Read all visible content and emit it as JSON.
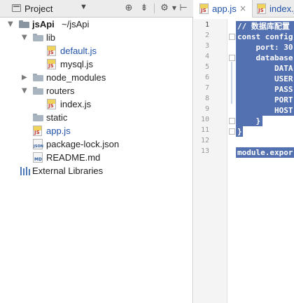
{
  "project_panel": {
    "title": "Project",
    "dropdown_icon": "triangle-down-icon",
    "toolbar_icons": [
      "crosshair-icon",
      "collapse-icon",
      "gear-icon",
      "hide-panel-icon"
    ]
  },
  "tree": {
    "root": {
      "name": "jsApi",
      "path": "~/jsApi"
    },
    "items": [
      {
        "label": "lib",
        "type": "folder",
        "state": "expanded"
      },
      {
        "label": "default.js",
        "type": "js-file",
        "color": "#2051a8"
      },
      {
        "label": "mysql.js",
        "type": "js-file"
      },
      {
        "label": "node_modules",
        "type": "folder",
        "state": "collapsed"
      },
      {
        "label": "routers",
        "type": "folder",
        "state": "expanded"
      },
      {
        "label": "index.js",
        "type": "js-file"
      },
      {
        "label": "static",
        "type": "folder"
      },
      {
        "label": "app.js",
        "type": "js-file",
        "color": "#2051a8"
      },
      {
        "label": "package-lock.json",
        "type": "json-file"
      },
      {
        "label": "README.md",
        "type": "md-file"
      }
    ],
    "external": {
      "label": "External Libraries",
      "icon": "library-icon"
    }
  },
  "editor": {
    "tabs": [
      {
        "label": "app.js",
        "active": true,
        "close": "×"
      },
      {
        "label": "index.j",
        "active": false
      }
    ],
    "line_numbers": [
      "1",
      "2",
      "3",
      "4",
      "5",
      "6",
      "7",
      "8",
      "9",
      "10",
      "11",
      "12",
      "13"
    ],
    "code_lines": [
      "// 数据库配置",
      "const config",
      "    port: 30",
      "    database",
      "        DATA",
      "        USER",
      "        PASS",
      "        PORT",
      "        HOST",
      "    }",
      "}",
      "",
      "module.expor"
    ],
    "selection_color": "#5370b0"
  }
}
